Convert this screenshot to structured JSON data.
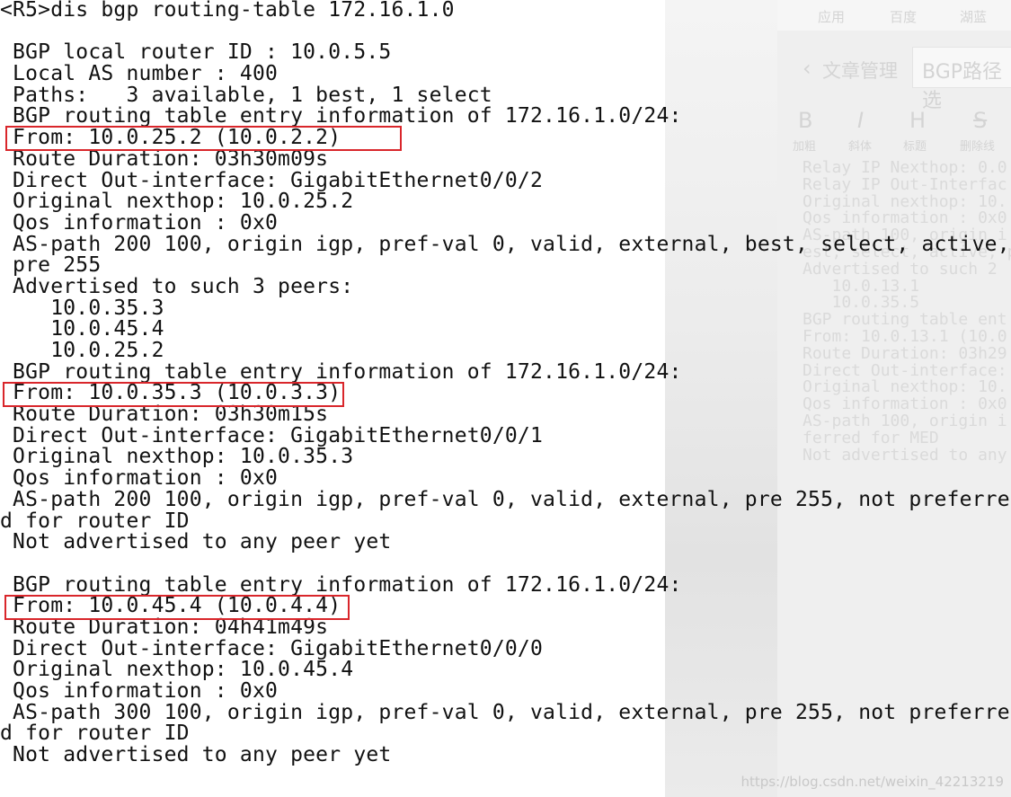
{
  "background": {
    "toolbar_items": [
      "应用",
      "百度",
      "湖蓝"
    ],
    "header_back": "文章管理",
    "header_title": "BGP路径选",
    "format_buttons": [
      {
        "glyph": "B",
        "label": "加粗"
      },
      {
        "glyph": "I",
        "label": "斜体"
      },
      {
        "glyph": "H",
        "label": "标题"
      },
      {
        "glyph": "S",
        "label": "删除线"
      }
    ],
    "ghost_lines": [
      "Relay IP Nexthop: 0.0",
      "Relay IP Out-Interfac",
      "Original nexthop: 10.",
      "Qos information : 0x0",
      "AS-path 100, origin i",
      "est, select, active, p",
      "Advertised to such 2",
      "   10.0.13.1",
      "   10.0.35.5",
      "BGP routing table ent",
      "From: 10.0.13.1 (10.0",
      "Route Duration: 03h29",
      "Direct Out-interface:",
      "Original nexthop: 10.",
      "Qos information : 0x0",
      "AS-path 100, origin i",
      "ferred for MED",
      "Not advertised to any"
    ]
  },
  "terminal": {
    "lines": [
      "<R5>dis bgp routing-table 172.16.1.0",
      "",
      " BGP local router ID : 10.0.5.5",
      " Local AS number : 400",
      " Paths:   3 available, 1 best, 1 select",
      " BGP routing table entry information of 172.16.1.0/24:",
      " From: 10.0.25.2 (10.0.2.2)",
      " Route Duration: 03h30m09s",
      " Direct Out-interface: GigabitEthernet0/0/2",
      " Original nexthop: 10.0.25.2",
      " Qos information : 0x0",
      " AS-path 200 100, origin igp, pref-val 0, valid, external, best, select, active,",
      " pre 255",
      " Advertised to such 3 peers:",
      "    10.0.35.3",
      "    10.0.45.4",
      "    10.0.25.2",
      " BGP routing table entry information of 172.16.1.0/24:",
      " From: 10.0.35.3 (10.0.3.3)",
      " Route Duration: 03h30m15s",
      " Direct Out-interface: GigabitEthernet0/0/1",
      " Original nexthop: 10.0.35.3",
      " Qos information : 0x0",
      " AS-path 200 100, origin igp, pref-val 0, valid, external, pre 255, not preferre",
      "d for router ID",
      " Not advertised to any peer yet",
      "",
      " BGP routing table entry information of 172.16.1.0/24:",
      " From: 10.0.45.4 (10.0.4.4)",
      " Route Duration: 04h41m49s",
      " Direct Out-interface: GigabitEthernet0/0/0",
      " Original nexthop: 10.0.45.4",
      " Qos information : 0x0",
      " AS-path 300 100, origin igp, pref-val 0, valid, external, pre 255, not preferre",
      "d for router ID",
      " Not advertised to any peer yet"
    ],
    "highlight_color": "#d9262b"
  },
  "watermark": "https://blog.csdn.net/weixin_42213219"
}
